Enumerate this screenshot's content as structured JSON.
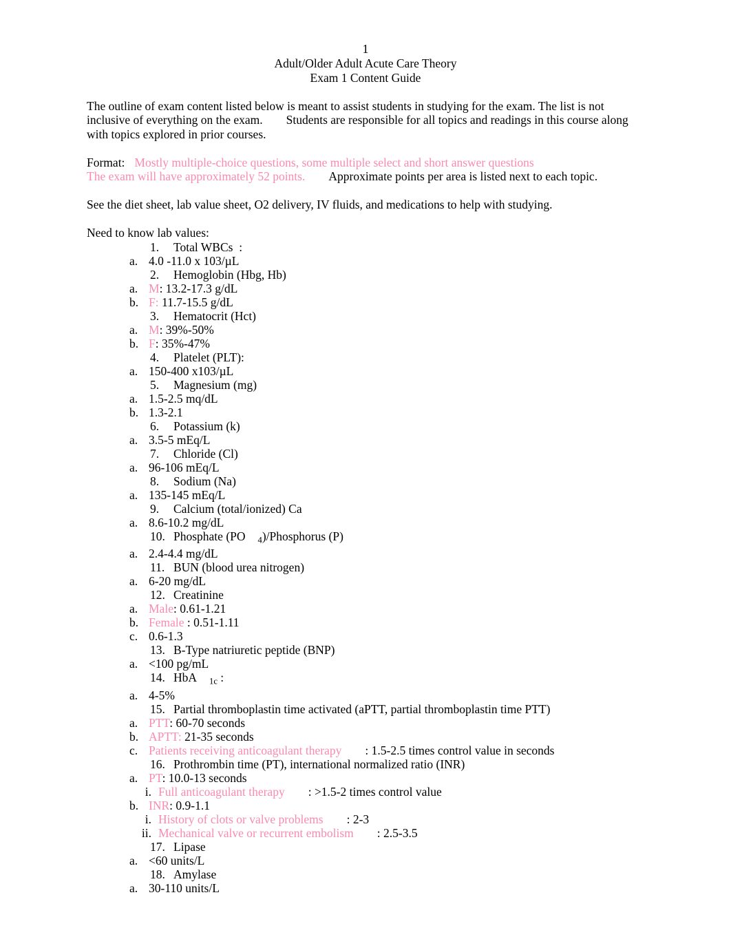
{
  "header": {
    "page_number": "1",
    "title_line_1": "Adult/Older Adult Acute Care Theory",
    "title_line_2": "Exam 1 Content Guide"
  },
  "intro": {
    "paragraph_line_1": "The outline of exam content listed below is meant to assist students in studying for the exam. The list is not",
    "paragraph_line_2a": "inclusive of everything on the exam.",
    "paragraph_line_2b": "Students are responsible for all topics and readings in this course along",
    "paragraph_line_3": "with topics explored in prior courses."
  },
  "format": {
    "label": "Format:",
    "value_pink": "Mostly multiple-choice questions, some multiple select and short answer questions",
    "points_pink": "The exam will have approximately 52 points.",
    "points_note": "Approximate points per area is listed next to each topic."
  },
  "resources": {
    "line": "See the diet sheet, lab value sheet, O2 delivery, IV fluids, and medications to help with studying."
  },
  "labs": {
    "heading": "Need to know lab values:",
    "items": [
      {
        "marker": "1.",
        "text": "Total WBCs  :",
        "children": [
          {
            "marker": "a.",
            "text": "4.0 -11.0 x 103/µL"
          }
        ]
      },
      {
        "marker": "2.",
        "text": "Hemoglobin (Hbg, Hb)",
        "children": [
          {
            "marker": "a.",
            "pink_prefix": "M",
            "text": ": 13.2-17.3 g/dL"
          },
          {
            "marker": "b.",
            "pink_prefix": "F:",
            "text": " 11.7-15.5 g/dL"
          }
        ]
      },
      {
        "marker": "3.",
        "text": "Hematocrit (Hct)",
        "children": [
          {
            "marker": "a.",
            "pink_prefix": "M",
            "text": ": 39%-50%"
          },
          {
            "marker": "b.",
            "pink_prefix": "F",
            "text": ": 35%-47%"
          }
        ]
      },
      {
        "marker": "4.",
        "text": "Platelet (PLT):",
        "children": [
          {
            "marker": "a.",
            "text": "150-400 x103/µL"
          }
        ]
      },
      {
        "marker": "5.",
        "text": "Magnesium (mg)",
        "children": [
          {
            "marker": "a.",
            "text": "1.5-2.5 mq/dL"
          },
          {
            "marker": "b.",
            "text": "1.3-2.1"
          }
        ]
      },
      {
        "marker": "6.",
        "text": "Potassium (k)",
        "children": [
          {
            "marker": "a.",
            "text": "3.5-5 mEq/L"
          }
        ]
      },
      {
        "marker": "7.",
        "text": "Chloride (Cl)",
        "children": [
          {
            "marker": "a.",
            "text": "96-106 mEq/L"
          }
        ]
      },
      {
        "marker": "8.",
        "text": "Sodium (Na)",
        "children": [
          {
            "marker": "a.",
            "text": "135-145 mEq/L"
          }
        ]
      },
      {
        "marker": "9.",
        "text": "Calcium (total/ionized) Ca",
        "children": [
          {
            "marker": "a.",
            "text": "8.6-10.2 mg/dL"
          }
        ]
      },
      {
        "marker": "10.",
        "text_before_sub": "Phosphate (PO",
        "subscript": "4",
        "text_after_sub": ")/Phosphorus (P)",
        "children": [
          {
            "marker": "a.",
            "text": "2.4-4.4 mg/dL"
          }
        ]
      },
      {
        "marker": "11.",
        "text": "BUN (blood urea nitrogen)",
        "children": [
          {
            "marker": "a.",
            "text": "6-20 mg/dL"
          }
        ]
      },
      {
        "marker": "12.",
        "text": "Creatinine",
        "children": [
          {
            "marker": "a.",
            "pink_prefix": "Male",
            "text": ": 0.61-1.21"
          },
          {
            "marker": "b.",
            "pink_prefix": "Female",
            "text": " : 0.51-1.11"
          },
          {
            "marker": "c.",
            "text": "0.6-1.3"
          }
        ]
      },
      {
        "marker": "13.",
        "text": "B-Type natriuretic peptide (BNP)",
        "children": [
          {
            "marker": "a.",
            "text": "<100 pg/mL"
          }
        ]
      },
      {
        "marker": "14.",
        "text_before_sub": "HbA",
        "subscript": "1c",
        "text_after_sub": " :",
        "children": [
          {
            "marker": "a.",
            "text": "4-5%"
          }
        ]
      },
      {
        "marker": "15.",
        "text": "Partial thromboplastin time activated (aPTT, partial thromboplastin time PTT)",
        "children": [
          {
            "marker": "a.",
            "pink_prefix": "PTT",
            "text": ": 60-70 seconds"
          },
          {
            "marker": "b.",
            "pink_prefix": "APTT:",
            "text": " 21-35 seconds"
          },
          {
            "marker": "c.",
            "pink_prefix": "Patients receiving anticoagulant therapy",
            "text": ": 1.5-2.5 times control value in seconds",
            "wide_gap": true
          }
        ]
      },
      {
        "marker": "16.",
        "text": "Prothrombin time (PT), international normalized ratio (INR)",
        "children": [
          {
            "marker": "a.",
            "pink_prefix": "PT",
            "text": ": 10.0-13 seconds",
            "grandchildren": [
              {
                "marker": "i.",
                "pink_prefix": "Full anticoagulant therapy",
                "text": ": >1.5-2 times control value",
                "wide_gap": true
              }
            ]
          },
          {
            "marker": "b.",
            "pink_prefix": "INR",
            "text": ": 0.9-1.1",
            "grandchildren": [
              {
                "marker": "i.",
                "pink_prefix": "History of clots or valve problems",
                "text": ": 2-3",
                "wide_gap": true
              },
              {
                "marker": "ii.",
                "pink_prefix": "Mechanical valve or recurrent embolism",
                "text": ": 2.5-3.5",
                "wide_gap": true
              }
            ]
          }
        ]
      },
      {
        "marker": "17.",
        "text": "Lipase",
        "children": [
          {
            "marker": "a.",
            "text": "<60 units/L"
          }
        ]
      },
      {
        "marker": "18.",
        "text": "Amylase",
        "children": [
          {
            "marker": "a.",
            "text": "30-110 units/L"
          }
        ]
      }
    ]
  },
  "colors": {
    "pink_accent": "#f98bb0",
    "text": "#000000",
    "background": "#ffffff"
  }
}
